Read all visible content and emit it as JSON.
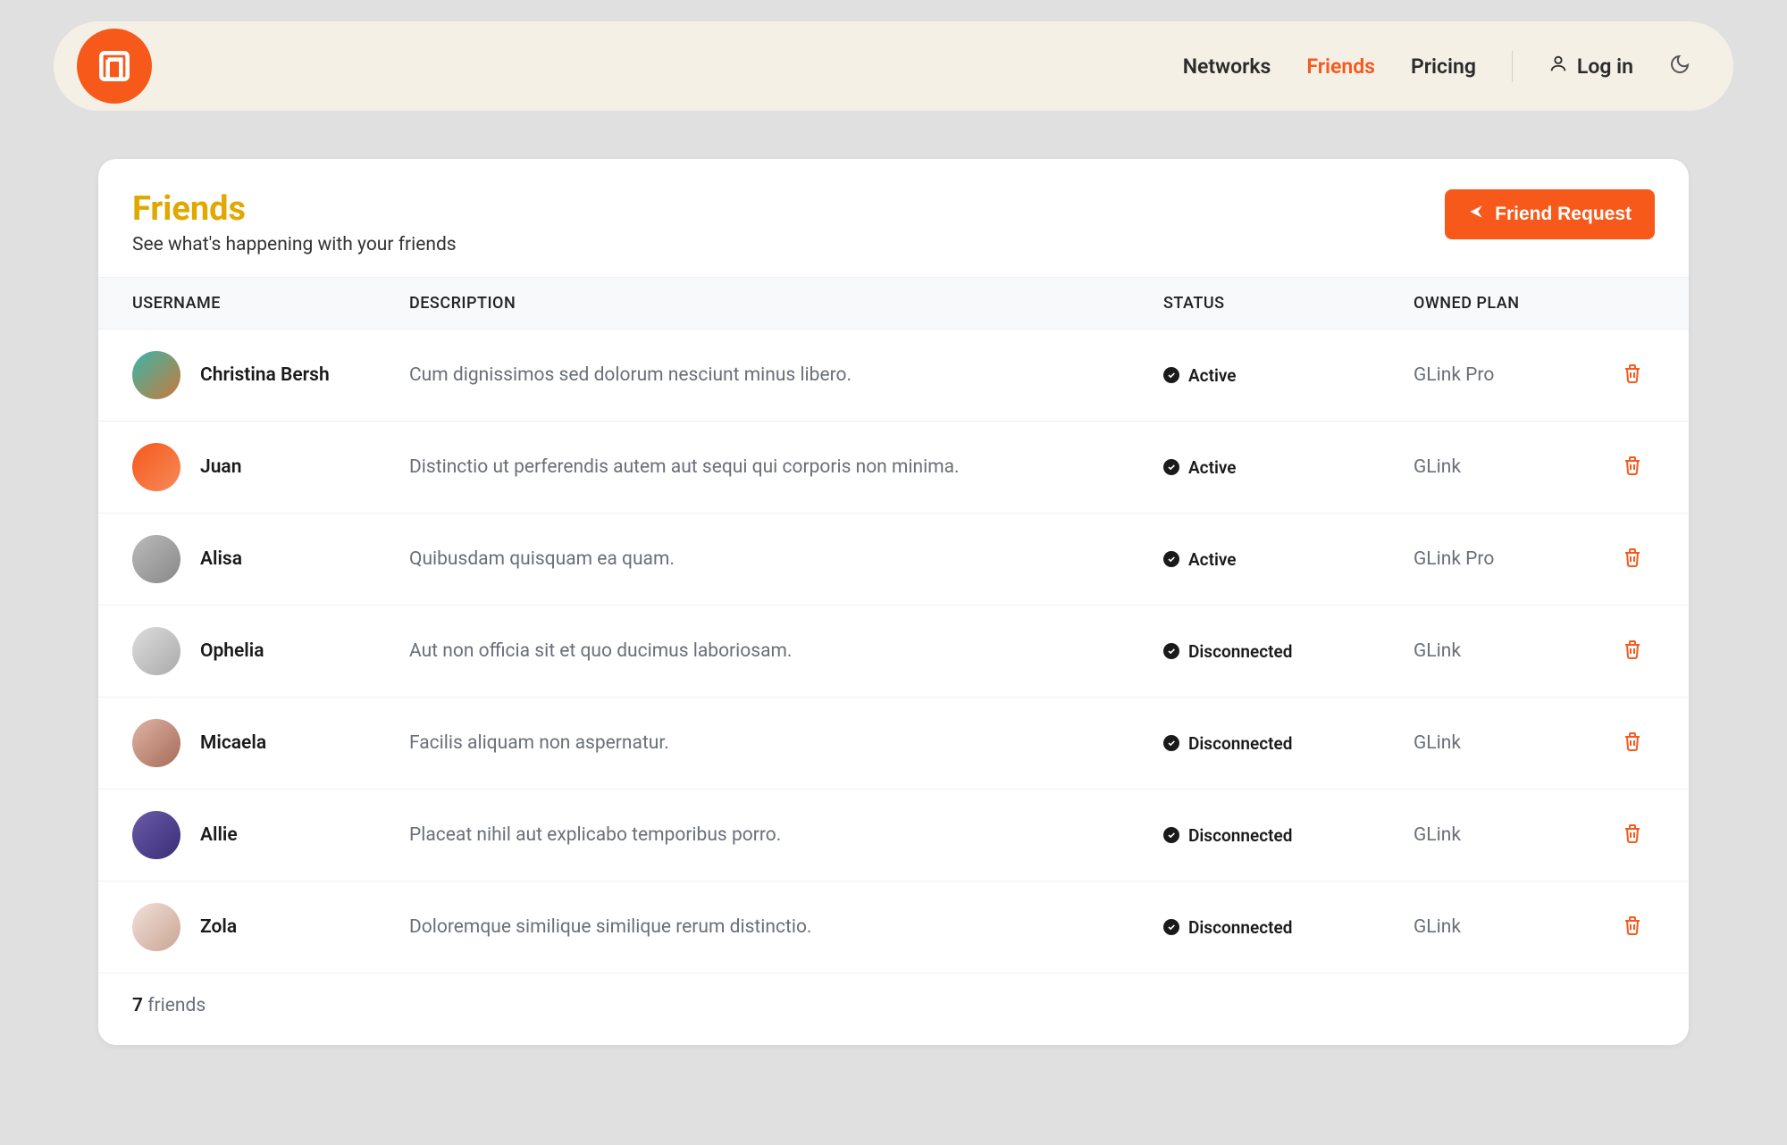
{
  "nav": {
    "links": [
      {
        "label": "Networks",
        "active": false
      },
      {
        "label": "Friends",
        "active": true
      },
      {
        "label": "Pricing",
        "active": false
      }
    ],
    "login_label": "Log in"
  },
  "page": {
    "title": "Friends",
    "subtitle": "See what's happening with your friends",
    "friend_request_label": "Friend Request"
  },
  "table": {
    "headers": {
      "username": "USERNAME",
      "description": "DESCRIPTION",
      "status": "STATUS",
      "owned_plan": "OWNED PLAN"
    },
    "rows": [
      {
        "username": "Christina Bersh",
        "description": "Cum dignissimos sed dolorum nesciunt minus libero.",
        "status": "Active",
        "plan": "GLink Pro"
      },
      {
        "username": "Juan",
        "description": "Distinctio ut perferendis autem aut sequi qui corporis non minima.",
        "status": "Active",
        "plan": "GLink"
      },
      {
        "username": "Alisa",
        "description": "Quibusdam quisquam ea quam.",
        "status": "Active",
        "plan": "GLink Pro"
      },
      {
        "username": "Ophelia",
        "description": "Aut non officia sit et quo ducimus laboriosam.",
        "status": "Disconnected",
        "plan": "GLink"
      },
      {
        "username": "Micaela",
        "description": "Facilis aliquam non aspernatur.",
        "status": "Disconnected",
        "plan": "GLink"
      },
      {
        "username": "Allie",
        "description": "Placeat nihil aut explicabo temporibus porro.",
        "status": "Disconnected",
        "plan": "GLink"
      },
      {
        "username": "Zola",
        "description": "Doloremque similique similique rerum distinctio.",
        "status": "Disconnected",
        "plan": "GLink"
      }
    ],
    "footer_count": "7",
    "footer_label": "friends"
  }
}
